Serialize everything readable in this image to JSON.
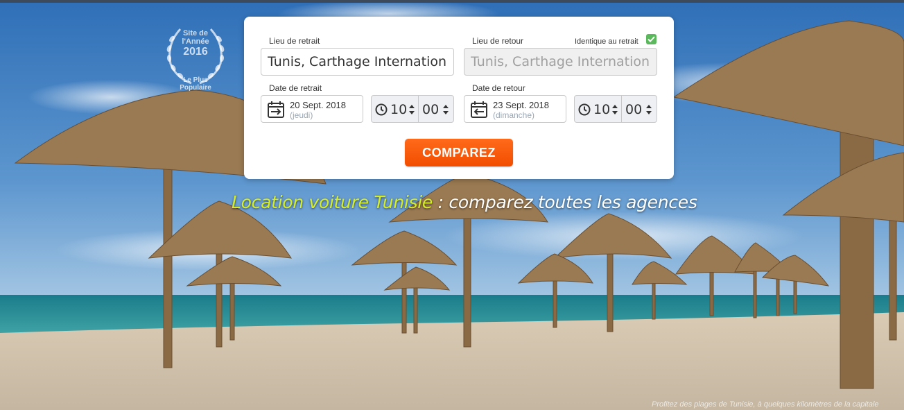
{
  "award": {
    "line1": "Site de",
    "line2": "l'Année",
    "year": "2016",
    "line3": "Le Plus",
    "line4": "Populaire"
  },
  "form": {
    "pickup_label": "Lieu de retrait",
    "pickup_value": "Tunis, Carthage International",
    "return_label": "Lieu de retour",
    "return_value": "Tunis, Carthage International",
    "same_label": "Identique au retrait",
    "same_checked": true,
    "pickup_date_label": "Date de retrait",
    "pickup_date": "20 Sept. 2018",
    "pickup_day": "(jeudi)",
    "pickup_hour": "10",
    "pickup_min": "00",
    "return_date_label": "Date de retour",
    "return_date": "23 Sept. 2018",
    "return_day": "(dimanche)",
    "return_hour": "10",
    "return_min": "00",
    "submit_label": "COMPAREZ"
  },
  "headline": {
    "highlight": "Location voiture Tunisie",
    "rest": " : comparez toutes les agences"
  },
  "caption": "Profitez des plages de Tunisie, à quelques kilomètres de la capitale",
  "colors": {
    "accent": "#f25a0a",
    "highlight": "#d6ee2a",
    "check": "#5cb85c"
  }
}
